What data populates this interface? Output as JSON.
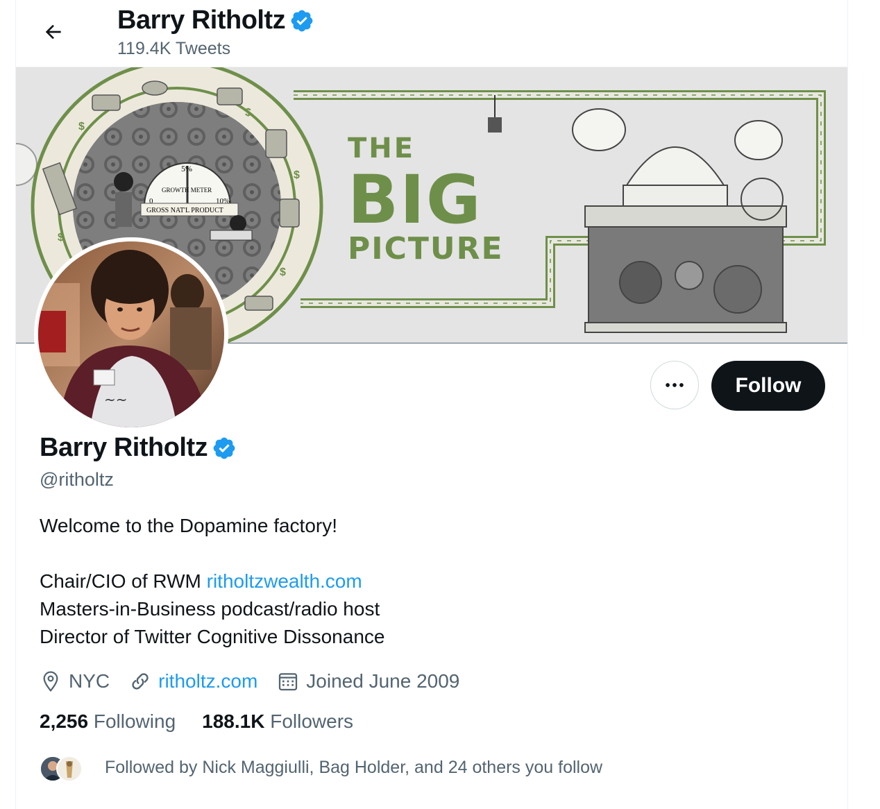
{
  "header": {
    "name": "Barry Ritholtz",
    "tweet_count": "119.4K Tweets"
  },
  "banner": {
    "line1": "THE",
    "line2": "BIG",
    "line3": "PICTURE",
    "gauge_percent": "5%",
    "gauge_low": "0",
    "gauge_high": "10%",
    "gauge_label": "GROWTH METER",
    "gauge_caption": "GROSS NAT'L PRODUCT",
    "accent_color": "#6e8f49"
  },
  "actions": {
    "follow_label": "Follow"
  },
  "profile": {
    "name": "Barry Ritholtz",
    "handle": "@ritholtz",
    "bio_line1": "Welcome to the Dopamine factory!",
    "bio_line2_prefix": "Chair/CIO of RWM ",
    "bio_line2_link": "ritholtzwealth.com",
    "bio_line3": "Masters-in-Business podcast/radio host",
    "bio_line4": "Director of Twitter Cognitive Dissonance",
    "location": "NYC",
    "website": "ritholtz.com",
    "joined": "Joined June 2009"
  },
  "stats": {
    "following_count": "2,256",
    "following_label": "Following",
    "followers_count": "188.1K",
    "followers_label": "Followers"
  },
  "followed_by": {
    "text": "Followed by Nick Maggiulli, Bag Holder, and 24 others you follow"
  },
  "colors": {
    "link": "#1d9bf0",
    "verified": "#1d9bf0",
    "muted": "#536471",
    "primary": "#0f1419"
  }
}
